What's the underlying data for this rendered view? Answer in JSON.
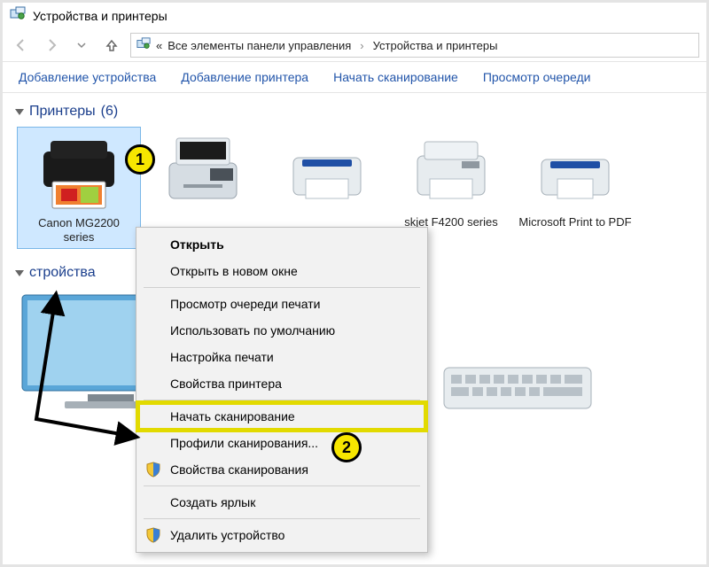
{
  "window": {
    "title": "Устройства и принтеры"
  },
  "breadcrumb": {
    "prefix": "«",
    "item1": "Все элементы панели управления",
    "item2": "Устройства и принтеры"
  },
  "toolbar": {
    "add_device": "Добавление устройства",
    "add_printer": "Добавление принтера",
    "start_scan": "Начать сканирование",
    "view_queue": "Просмотр очереди"
  },
  "groups": {
    "printers": {
      "label": "Принтеры",
      "count": "(6)"
    },
    "devices": {
      "label": "стройства"
    }
  },
  "devices": {
    "printers": [
      {
        "name": "Canon MG2200 series"
      },
      {
        "name": ""
      },
      {
        "name": ""
      },
      {
        "name": "skjet F4200 series"
      },
      {
        "name": "Microsoft Print to PDF"
      }
    ]
  },
  "contextmenu": {
    "open": "Открыть",
    "open_new_window": "Открыть в новом окне",
    "view_print_queue": "Просмотр очереди печати",
    "use_default": "Использовать по умолчанию",
    "print_setup": "Настройка печати",
    "printer_props": "Свойства принтера",
    "start_scan": "Начать сканирование",
    "scan_profiles": "Профили сканирования...",
    "scan_props": "Свойства сканирования",
    "create_shortcut": "Создать ярлык",
    "remove_device": "Удалить устройство"
  },
  "annotations": {
    "one": "1",
    "two": "2"
  }
}
